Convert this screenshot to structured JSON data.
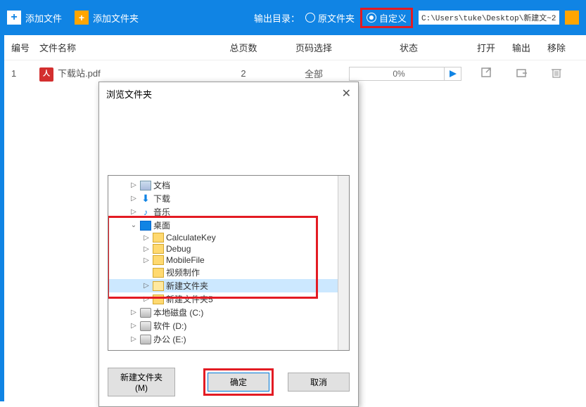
{
  "toolbar": {
    "add_file": "添加文件",
    "add_folder": "添加文件夹",
    "output_label": "输出目录：",
    "radio_source": "原文件夹",
    "radio_custom": "自定义",
    "path_value": "C:\\Users\\tuke\\Desktop\\新建文~2"
  },
  "headers": {
    "num": "编号",
    "name": "文件名称",
    "pages": "总页数",
    "select": "页码选择",
    "status": "状态",
    "open": "打开",
    "output": "输出",
    "remove": "移除"
  },
  "row": {
    "num": "1",
    "name": "下载站.pdf",
    "pages": "2",
    "select": "全部",
    "progress": "0%"
  },
  "dialog": {
    "title": "浏览文件夹",
    "new_folder": "新建文件夹(M)",
    "ok": "确定",
    "cancel": "取消"
  },
  "tree": {
    "docs": "文档",
    "downloads": "下载",
    "music": "音乐",
    "desktop": "桌面",
    "calculatekey": "CalculateKey",
    "debug": "Debug",
    "mobilefile": "MobileFile",
    "video": "视频制作",
    "newfolder": "新建文件夹",
    "newfolder5": "新建文件夹5",
    "diskc": "本地磁盘 (C:)",
    "diskd": "软件 (D:)",
    "diske": "办公 (E:)"
  }
}
